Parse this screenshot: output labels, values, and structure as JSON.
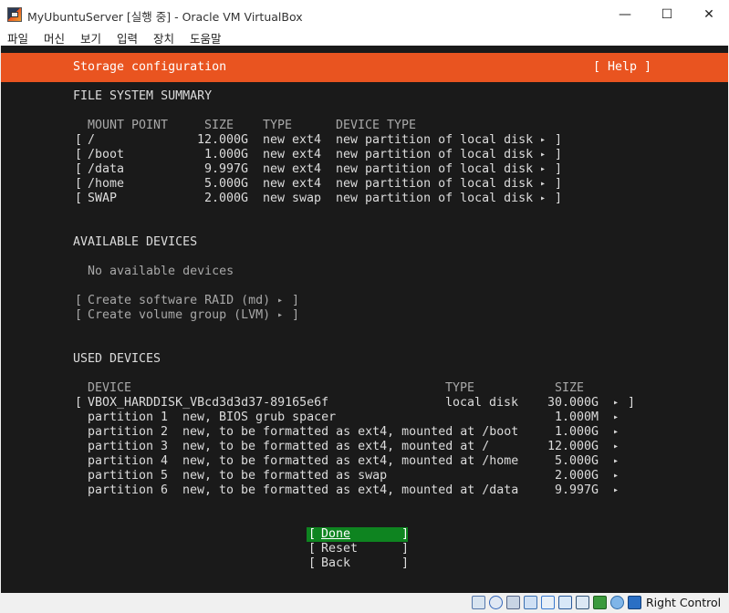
{
  "window": {
    "title": "MyUbuntuServer [실행 중] - Oracle VM VirtualBox",
    "minimize_glyph": "—",
    "maximize_glyph": "☐",
    "close_glyph": "✕"
  },
  "menu": [
    "파일",
    "머신",
    "보기",
    "입력",
    "장치",
    "도움말"
  ],
  "installer": {
    "header_title": "Storage configuration",
    "help_label": "[ Help ]",
    "fs_summary": {
      "title": "FILE SYSTEM SUMMARY",
      "columns": [
        "MOUNT POINT",
        "SIZE",
        "TYPE",
        "DEVICE TYPE"
      ],
      "rows": [
        {
          "mount": "/",
          "size": "12.000G",
          "type": "new ext4",
          "device_type": "new partition of local disk"
        },
        {
          "mount": "/boot",
          "size": "1.000G",
          "type": "new ext4",
          "device_type": "new partition of local disk"
        },
        {
          "mount": "/data",
          "size": "9.997G",
          "type": "new ext4",
          "device_type": "new partition of local disk"
        },
        {
          "mount": "/home",
          "size": "5.000G",
          "type": "new ext4",
          "device_type": "new partition of local disk"
        },
        {
          "mount": "SWAP",
          "size": "2.000G",
          "type": "new swap",
          "device_type": "new partition of local disk"
        }
      ]
    },
    "available": {
      "title": "AVAILABLE DEVICES",
      "empty_text": "No available devices",
      "create_raid": "Create software RAID (md)",
      "create_lvm": "Create volume group (LVM)"
    },
    "used": {
      "title": "USED DEVICES",
      "columns": [
        "DEVICE",
        "TYPE",
        "SIZE"
      ],
      "disk": {
        "name": "VBOX_HARDDISK_VBcd3d3d37-89165e6f",
        "type": "local disk",
        "size": "30.000G"
      },
      "partitions": [
        {
          "name": "partition 1",
          "desc": "new, BIOS grub spacer",
          "size": "1.000M"
        },
        {
          "name": "partition 2",
          "desc": "new, to be formatted as ext4, mounted at /boot",
          "size": "1.000G"
        },
        {
          "name": "partition 3",
          "desc": "new, to be formatted as ext4, mounted at /",
          "size": "12.000G"
        },
        {
          "name": "partition 4",
          "desc": "new, to be formatted as ext4, mounted at /home",
          "size": "5.000G"
        },
        {
          "name": "partition 5",
          "desc": "new, to be formatted as swap",
          "size": "2.000G"
        },
        {
          "name": "partition 6",
          "desc": "new, to be formatted as ext4, mounted at /data",
          "size": "9.997G"
        }
      ]
    },
    "buttons": {
      "done": "Done",
      "reset": "Reset",
      "back": "Back"
    },
    "glyphs": {
      "open_bracket": "[",
      "close_bracket": "]",
      "arrow": "▸"
    },
    "colors": {
      "accent": "#e95420",
      "done_button": "#0e8420",
      "background": "#1a1a1a"
    }
  },
  "statusbar": {
    "host_key": "Right Control",
    "icons": [
      "harddisk-icon",
      "optical-disk-icon",
      "audio-icon",
      "network-icon",
      "usb-icon",
      "shared-folder-icon",
      "display-icon",
      "recording-icon",
      "cpu-icon",
      "mouse-integration-icon",
      "keyboard-icon"
    ]
  }
}
